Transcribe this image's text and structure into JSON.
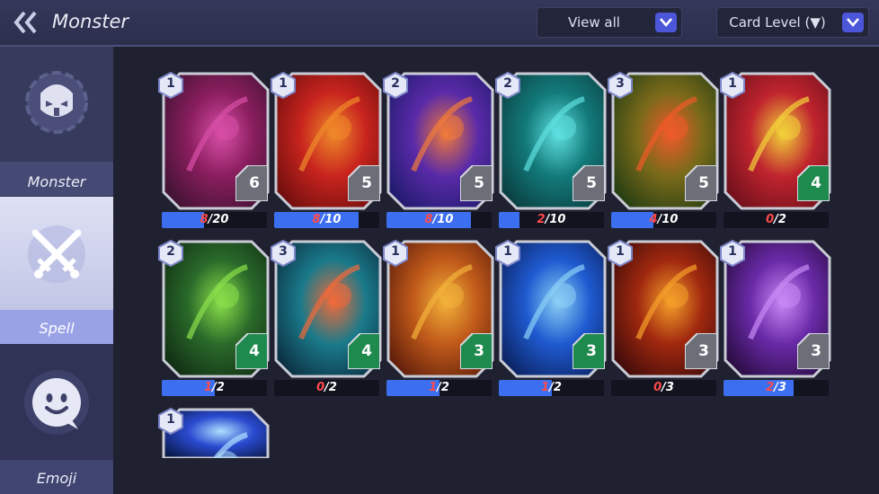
{
  "header": {
    "title": "Monster",
    "filter_label": "View all",
    "sort_label": "Card Level (▼)"
  },
  "sidebar": {
    "tabs": [
      {
        "label": "Monster",
        "icon": "monster-helmet-icon",
        "selected": false
      },
      {
        "label": "Spell",
        "icon": "crossed-swords-icon",
        "selected": true
      },
      {
        "label": "Emoji",
        "icon": "smiley-icon",
        "selected": false
      }
    ]
  },
  "cards": [
    {
      "art": "pink-chains",
      "level": "1",
      "cost": "6",
      "owned": "8",
      "needed": "20",
      "progress": 0.4,
      "cost_color": "#6c6e78"
    },
    {
      "art": "fire-figure",
      "level": "1",
      "cost": "5",
      "owned": "8",
      "needed": "10",
      "progress": 0.8,
      "cost_color": "#6c6e78"
    },
    {
      "art": "energy-beam",
      "level": "2",
      "cost": "5",
      "owned": "8",
      "needed": "10",
      "progress": 0.8,
      "cost_color": "#6c6e78"
    },
    {
      "art": "spirit-orb",
      "level": "2",
      "cost": "5",
      "owned": "2",
      "needed": "10",
      "progress": 0.2,
      "cost_color": "#6c6e78"
    },
    {
      "art": "flame-slash",
      "level": "3",
      "cost": "5",
      "owned": "4",
      "needed": "10",
      "progress": 0.4,
      "cost_color": "#6c6e78"
    },
    {
      "art": "holy-sword",
      "level": "1",
      "cost": "4",
      "owned": "0",
      "needed": "2",
      "progress": 0,
      "cost_color": "#1f8a4e"
    },
    {
      "art": "poison-tree",
      "level": "2",
      "cost": "4",
      "owned": "1",
      "needed": "2",
      "progress": 0.5,
      "cost_color": "#1f8a4e"
    },
    {
      "art": "spirit-spin",
      "level": "3",
      "cost": "4",
      "owned": "0",
      "needed": "2",
      "progress": 0,
      "cost_color": "#1f8a4e"
    },
    {
      "art": "crowd-rally",
      "level": "1",
      "cost": "3",
      "owned": "1",
      "needed": "2",
      "progress": 0.5,
      "cost_color": "#1f8a4e"
    },
    {
      "art": "whirlpool",
      "level": "1",
      "cost": "3",
      "owned": "1",
      "needed": "2",
      "progress": 0.5,
      "cost_color": "#1f8a4e"
    },
    {
      "art": "flame-demon",
      "level": "1",
      "cost": "3",
      "owned": "0",
      "needed": "3",
      "progress": 0,
      "cost_color": "#6c6e78"
    },
    {
      "art": "shadow-claw",
      "level": "1",
      "cost": "3",
      "owned": "2",
      "needed": "3",
      "progress": 0.667,
      "cost_color": "#6c6e78"
    },
    {
      "art": "lightning",
      "level": "1",
      "cost": "",
      "owned": "",
      "needed": "",
      "progress": 0,
      "cost_color": "#6c6e78"
    }
  ],
  "colors": {
    "progress_fill": "#3c6ef0",
    "owned_text": "#ff4a4a",
    "accent_button": "#4c56d9"
  }
}
